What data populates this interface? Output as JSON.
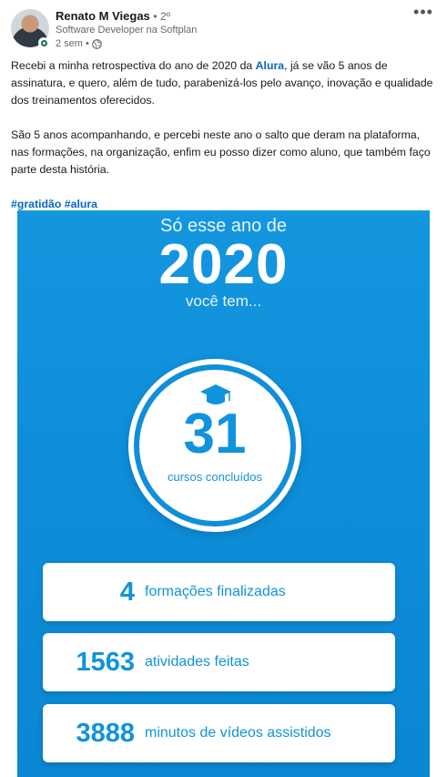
{
  "post": {
    "author": "Renato M Viegas",
    "degree": "• 2º",
    "headline": "Software Developer na Softplan",
    "time": "2 sem •",
    "more": "•••",
    "text1_before": "Recebi a minha retrospectiva do ano de 2020 da ",
    "text1_link": "Alura",
    "text1_after": ", já se vão 5 anos de assinatura, e quero, além de tudo, parabenizá-los pelo avanço, inovação e qualidade dos treinamentos oferecidos.",
    "text2": "São 5 anos acompanhando, e percebi neste ano o salto que deram na plataforma, nas formações, na organização, enfim eu posso dizer como aluno, que também faço parte desta história.",
    "hashtags": "#gratidão #alura"
  },
  "image": {
    "line1": "Só esse ano de",
    "year": "2020",
    "line3": "você tem...",
    "courses_number": "31",
    "courses_label": "cursos concluídos",
    "stats": [
      {
        "number": "4",
        "label": "formações finalizadas"
      },
      {
        "number": "1563",
        "label": "atividades feitas"
      },
      {
        "number": "3888",
        "label": "minutos de vídeos assistidos"
      }
    ]
  },
  "colors": {
    "link": "#0a66c2",
    "image_bg": "#0e8ed9",
    "accent": "#1093dd",
    "online": "#057642"
  },
  "icons": [
    "online-status-icon",
    "globe-icon",
    "more-icon",
    "graduation-cap-icon"
  ]
}
